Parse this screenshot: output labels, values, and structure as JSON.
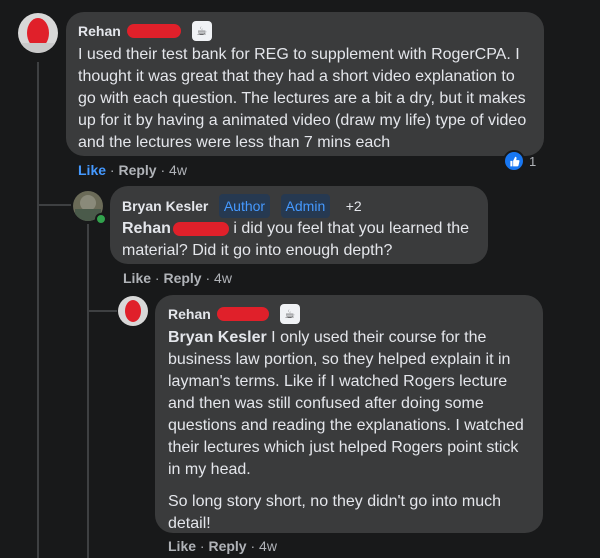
{
  "comments": [
    {
      "author": "Rehan",
      "text": "I used their test bank for REG to supplement with RogerCPA. I thought it was great that they had a short video explanation to go with each question. The lectures are a bit a dry, but it makes up for it by having a animated video (draw my life) type of video and the lectures were less than 7 mins each",
      "actions": {
        "like": "Like",
        "reply": "Reply",
        "time": "4w"
      },
      "reactions": {
        "count": "1"
      }
    },
    {
      "author": "Bryan Kesler",
      "tags": [
        "Author",
        "Admin",
        "+2"
      ],
      "mention": "Rehan",
      "text_after": "i did you feel that you learned the material? Did it go into enough depth?",
      "actions": {
        "like": "Like",
        "reply": "Reply",
        "time": "4w"
      }
    },
    {
      "author": "Rehan",
      "mention": "Bryan Kesler",
      "text1": "I only used their course for the business law portion, so they helped explain it in layman's terms. Like if I watched Rogers lecture and then was still confused after doing some questions and reading the explanations. I watched their lectures which just helped Rogers point stick in my head.",
      "text2": "So long story short, no they didn't go into much detail!",
      "actions": {
        "like": "Like",
        "reply": "Reply",
        "time": "4w"
      }
    }
  ],
  "separator": " · ",
  "icons": {
    "badge": "coffee-cup-icon",
    "like": "thumbs-up-icon"
  },
  "colors": {
    "bubble": "#3a3b3c",
    "link": "#4599ff",
    "redaction": "#e0202a",
    "like_blue": "#1877f2"
  }
}
